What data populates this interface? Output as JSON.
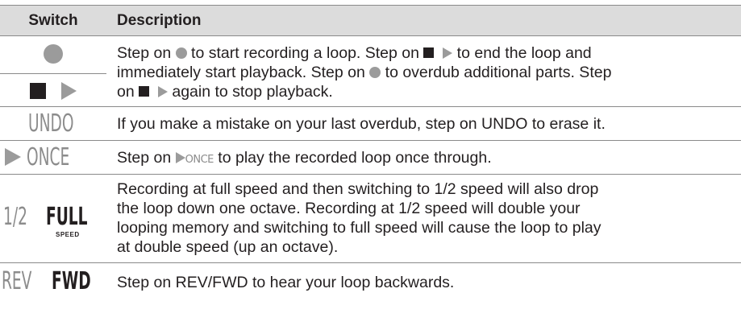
{
  "table": {
    "header": {
      "switch": "Switch",
      "description": "Description"
    },
    "rows": {
      "record": {
        "line1": [
          "Step on ",
          " to start recording a loop. Step on ",
          " to end the loop and"
        ],
        "line2": "immediately start playback. Step on ",
        "line2b": " to overdub additional parts. Step",
        "line3a": "on ",
        "line3b": " again to stop playback."
      },
      "undo": {
        "switch_label": "UNDO",
        "description": "If you make a mistake on your last overdub, step on UNDO to erase it."
      },
      "once": {
        "switch_label": "ONCE",
        "desc_a": "Step on ",
        "desc_once": "ONCE",
        "desc_b": " to play the recorded loop once through."
      },
      "speed": {
        "switch_half": "1/2",
        "switch_full": "FULL",
        "switch_speed": "SPEED",
        "lines": [
          "Recording at full speed and then switching to 1/2 speed will also drop",
          "the loop down one octave. Recording at 1/2 speed will double your",
          "looping memory and switching to full speed will cause the loop to play",
          "at double speed (up an octave)."
        ]
      },
      "reverse": {
        "switch_rev": "REV",
        "switch_fwd": "FWD",
        "description": "Step on REV/FWD to hear your loop backwards."
      }
    }
  },
  "colors": {
    "header_bg": "#dcdcdc",
    "rule": "#8a8a8a",
    "gray_glyph": "#8c8c8c",
    "text": "#231f20"
  },
  "icons": [
    "record-circle-icon",
    "stop-square-icon",
    "play-triangle-icon"
  ]
}
